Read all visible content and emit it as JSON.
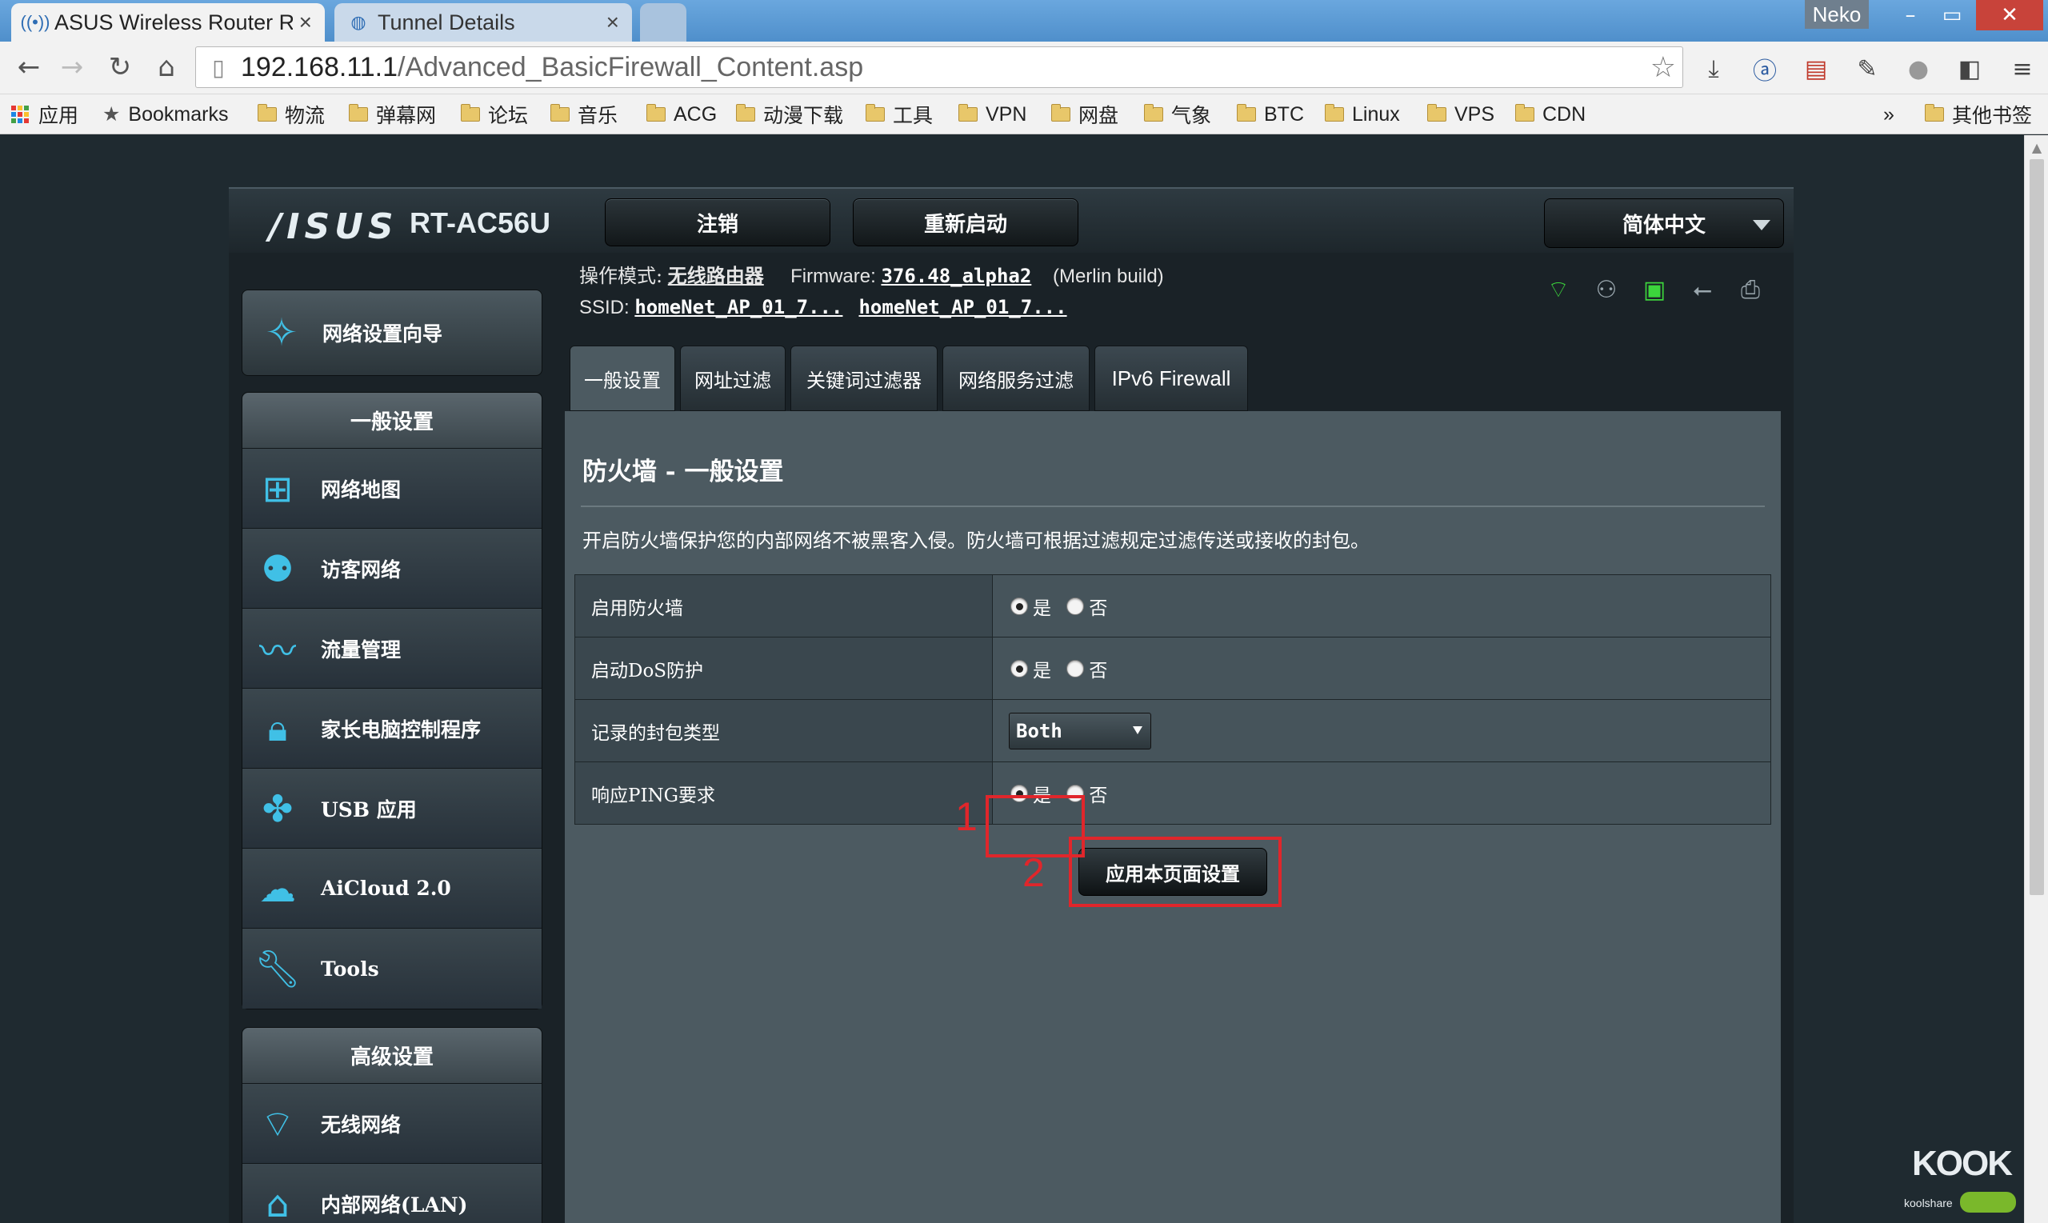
{
  "browser": {
    "tabs": [
      {
        "title": "ASUS Wireless Router R",
        "icon": "wireless-icon",
        "active": true
      },
      {
        "title": "Tunnel Details",
        "icon": "globe-icon",
        "active": false
      }
    ],
    "user": "Neko",
    "url_host": "192.168.11.1",
    "url_path": "/Advanced_BasicFirewall_Content.asp",
    "bookmarks": {
      "apps": "应用",
      "bookmarks": "Bookmarks",
      "folders": [
        "物流",
        "弹幕网",
        "论坛",
        "音乐",
        "ACG",
        "动漫下载",
        "工具",
        "VPN",
        "网盘",
        "气象",
        "BTC",
        "Linux",
        "VPS",
        "CDN"
      ],
      "overflow": "»",
      "other": "其他书签"
    }
  },
  "router": {
    "brand": "/ISUS",
    "model": "RT-AC56U",
    "logout": "注销",
    "reboot": "重新启动",
    "language": "简体中文",
    "op_mode_label": "操作模式:",
    "op_mode_value": "无线路由器",
    "firmware_label": "Firmware:",
    "firmware_value": "376.48_alpha2",
    "firmware_note": "(Merlin build)",
    "ssid_label": "SSID:",
    "ssid_1": "homeNet_AP_01_7...",
    "ssid_2": "homeNet_AP_01_7...",
    "status_icons": [
      "wifi-status-icon",
      "clients-status-icon",
      "network-status-icon",
      "usb-status-icon",
      "printer-status-icon"
    ]
  },
  "sidebar": {
    "wizard": "网络设置向导",
    "general_header": "一般设置",
    "general_items": [
      {
        "label": "网络地图",
        "icon": "network-map-icon"
      },
      {
        "label": "访客网络",
        "icon": "guest-network-icon"
      },
      {
        "label": "流量管理",
        "icon": "traffic-icon"
      },
      {
        "label": "家长电脑控制程序",
        "icon": "lock-icon"
      },
      {
        "label": "USB 应用",
        "icon": "puzzle-icon"
      },
      {
        "label": "AiCloud 2.0",
        "icon": "cloud-icon"
      },
      {
        "label": "Tools",
        "icon": "wrench-icon"
      }
    ],
    "advanced_header": "高级设置",
    "advanced_items": [
      {
        "label": "无线网络",
        "icon": "wifi-icon"
      },
      {
        "label": "内部网络(LAN)",
        "icon": "home-icon"
      }
    ]
  },
  "content": {
    "tabs": [
      "一般设置",
      "网址过滤",
      "关键词过滤器",
      "网络服务过滤",
      "IPv6 Firewall"
    ],
    "title": "防火墙 - 一般设置",
    "description": "开启防火墙保护您的内部网络不被黑客入侵。防火墙可根据过滤规定过滤传送或接收的封包。",
    "yes": "是",
    "no": "否",
    "rows": [
      {
        "label": "启用防火墙",
        "type": "radio",
        "value": "是"
      },
      {
        "label": "启动DoS防护",
        "type": "radio",
        "value": "是"
      },
      {
        "label": "记录的封包类型",
        "type": "select",
        "value": "Both"
      },
      {
        "label": "响应PING要求",
        "type": "radio",
        "value": "是"
      }
    ],
    "apply": "应用本页面设置",
    "annotations": [
      "1",
      "2"
    ]
  },
  "watermark": {
    "text": "KOOK",
    "sub": "koolshare"
  }
}
